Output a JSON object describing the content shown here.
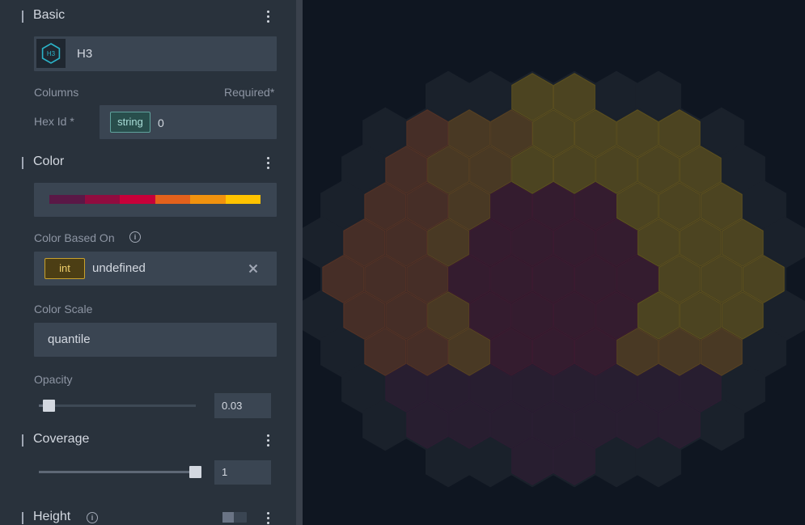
{
  "basic": {
    "title": "Basic",
    "layer_type_icon": "h3-hexagon-icon",
    "layer_type_icon_text": "H3",
    "layer_type_label": "H3",
    "columns_label": "Columns",
    "required_label": "Required*",
    "hex_id_label": "Hex Id *",
    "hex_id_type": "string",
    "hex_id_value": "0"
  },
  "color": {
    "title": "Color",
    "palette": [
      "#5a1846",
      "#900c3f",
      "#c70039",
      "#e3611c",
      "#f1920e",
      "#ffc300"
    ],
    "color_based_on_label": "Color Based On",
    "field_type": "int",
    "field_value": "undefined",
    "color_scale_label": "Color Scale",
    "color_scale_value": "quantile",
    "opacity_label": "Opacity",
    "opacity_value": "0.03",
    "opacity_fraction": 0.03
  },
  "coverage": {
    "title": "Coverage",
    "value": "1",
    "fraction": 1.0
  },
  "height": {
    "title": "Height",
    "enabled": false
  },
  "colors": {
    "panel_bg": "#29323c",
    "input_bg": "#3a4552",
    "map_bg": "#0f1621"
  }
}
